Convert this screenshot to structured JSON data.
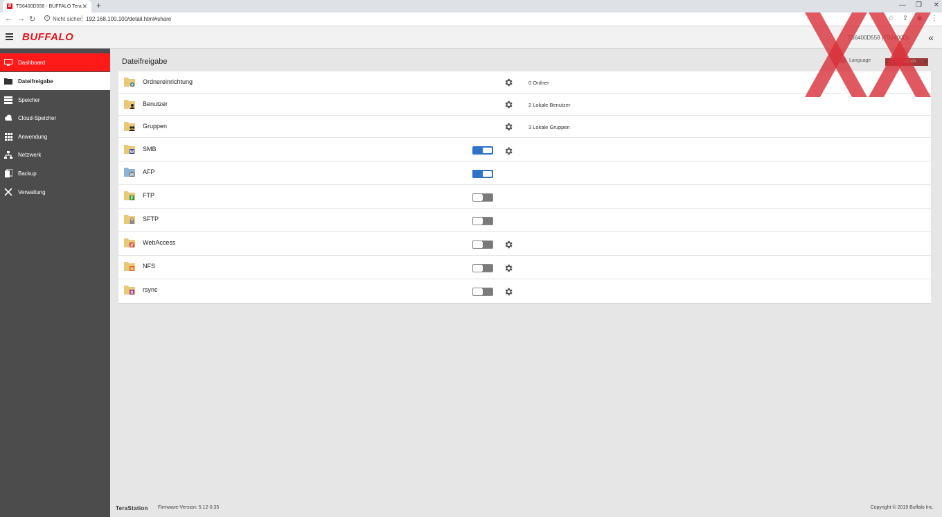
{
  "browser": {
    "tab_title": "TS6400D558 - BUFFALO TeraStati",
    "tab_favicon": "B",
    "url_secure_label": "Nicht sicher",
    "url": "192.168.100.100/detail.html#share"
  },
  "header": {
    "logo": "BUFFALO",
    "device_name": "TS6400D558 (TS6400D)"
  },
  "sidebar": {
    "items": [
      {
        "label": "Dashboard",
        "icon": "monitor-icon"
      },
      {
        "label": "Dateifreigabe",
        "icon": "folder-icon"
      },
      {
        "label": "Speicher",
        "icon": "storage-icon"
      },
      {
        "label": "Cloud-Speicher",
        "icon": "cloud-icon"
      },
      {
        "label": "Anwendung",
        "icon": "grid-icon"
      },
      {
        "label": "Netzwerk",
        "icon": "network-icon"
      },
      {
        "label": "Backup",
        "icon": "backup-icon"
      },
      {
        "label": "Verwaltung",
        "icon": "tools-icon"
      }
    ]
  },
  "main": {
    "title": "Dateifreigabe",
    "language_label": "Language",
    "language_value": "Deutsch"
  },
  "rows": [
    {
      "label": "Ordnereinrichtung",
      "info": "0 Ordner",
      "badge": "+",
      "badge_color": "#2a6a8a"
    },
    {
      "label": "Benutzer",
      "info": "2 Lokale Benutzer",
      "badge": "",
      "badge_color": "#222"
    },
    {
      "label": "Gruppen",
      "info": "3 Lokale Gruppen",
      "badge": "",
      "badge_color": "#222"
    },
    {
      "label": "SMB",
      "toggle": true,
      "badge": "W",
      "badge_color": "#2f4fa0"
    },
    {
      "label": "AFP",
      "toggle": true,
      "badge": "M",
      "badge_color": "#777"
    },
    {
      "label": "FTP",
      "toggle": false,
      "badge": "F",
      "badge_color": "#3a9a3a"
    },
    {
      "label": "SFTP",
      "toggle": false,
      "badge": "",
      "badge_color": "#888"
    },
    {
      "label": "WebAccess",
      "toggle": false,
      "badge": "W",
      "badge_color": "#c0302a"
    },
    {
      "label": "NFS",
      "toggle": false,
      "badge": "N",
      "badge_color": "#e06a1a"
    },
    {
      "label": "rsync",
      "toggle": false,
      "badge": "R",
      "badge_color": "#9a2a7a"
    }
  ],
  "footer": {
    "brand": "TeraStation",
    "firmware": "Firmware-Version: 5.12-0.35",
    "copyright": "Copyright © 2019 Buffalo Inc."
  },
  "colors": {
    "accent_red": "#ff1a1a",
    "sidebar_bg": "#4c4c4c",
    "toggle_on": "#2f73c9"
  }
}
